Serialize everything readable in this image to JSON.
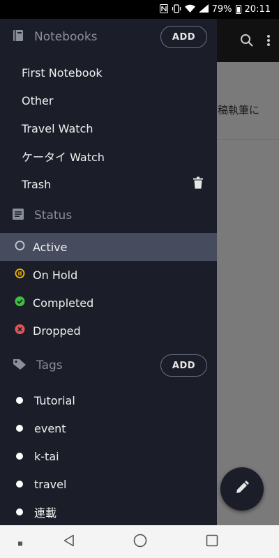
{
  "status_bar": {
    "battery": "79%",
    "time": "20:11"
  },
  "background": {
    "text": "稿執筆に"
  },
  "notebooks": {
    "title": "Notebooks",
    "add_label": "ADD",
    "items": [
      {
        "label": "First Notebook"
      },
      {
        "label": "Other"
      },
      {
        "label": "Travel Watch"
      },
      {
        "label": "ケータイ Watch"
      },
      {
        "label": "Trash"
      }
    ]
  },
  "status": {
    "title": "Status",
    "items": [
      {
        "label": "Active",
        "color": "#c9cbd2"
      },
      {
        "label": "On Hold",
        "color": "#f5b800"
      },
      {
        "label": "Completed",
        "color": "#3fbf3f"
      },
      {
        "label": "Dropped",
        "color": "#e05555"
      }
    ]
  },
  "tags": {
    "title": "Tags",
    "add_label": "ADD",
    "items": [
      {
        "label": "Tutorial"
      },
      {
        "label": "event"
      },
      {
        "label": "k-tai"
      },
      {
        "label": "travel"
      },
      {
        "label": "連載"
      }
    ]
  },
  "colors": {
    "drawer_bg": "#1b1e28",
    "active_row": "#464b5e",
    "header_text": "#8a8f9c"
  }
}
